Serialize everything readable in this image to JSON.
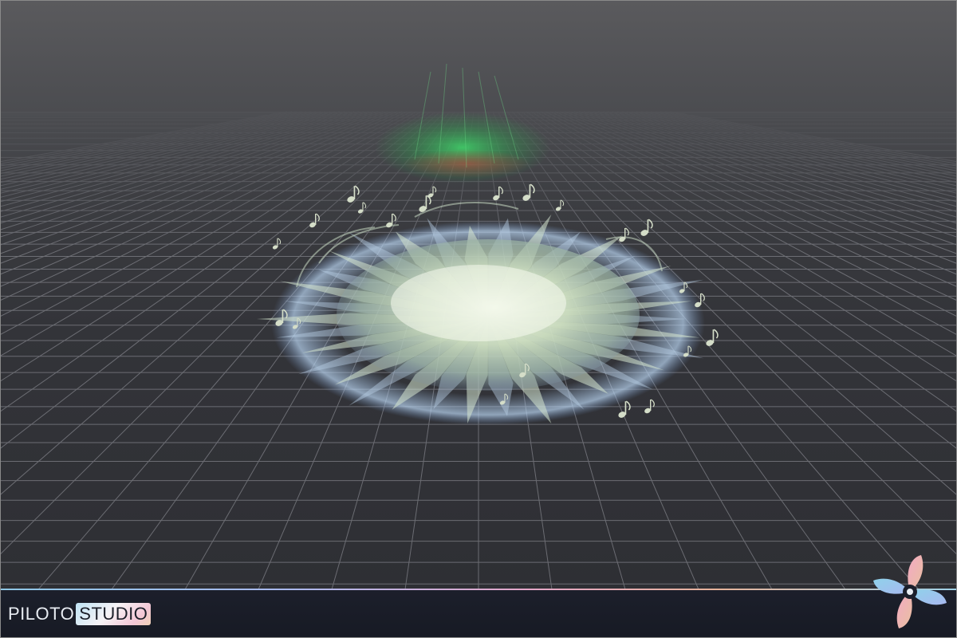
{
  "brand": {
    "name_part_1": "PILOTO",
    "name_part_2": "STUDIO"
  },
  "colors": {
    "vfx_core": "#e6f2d8",
    "vfx_edge": "#8fb4e0",
    "glow_green": "#3fd86a",
    "glow_red": "#d83a3a",
    "grid_line": "#7f8087"
  },
  "icons": {
    "logo": "fan-icon",
    "effect": "music-note-icon"
  }
}
